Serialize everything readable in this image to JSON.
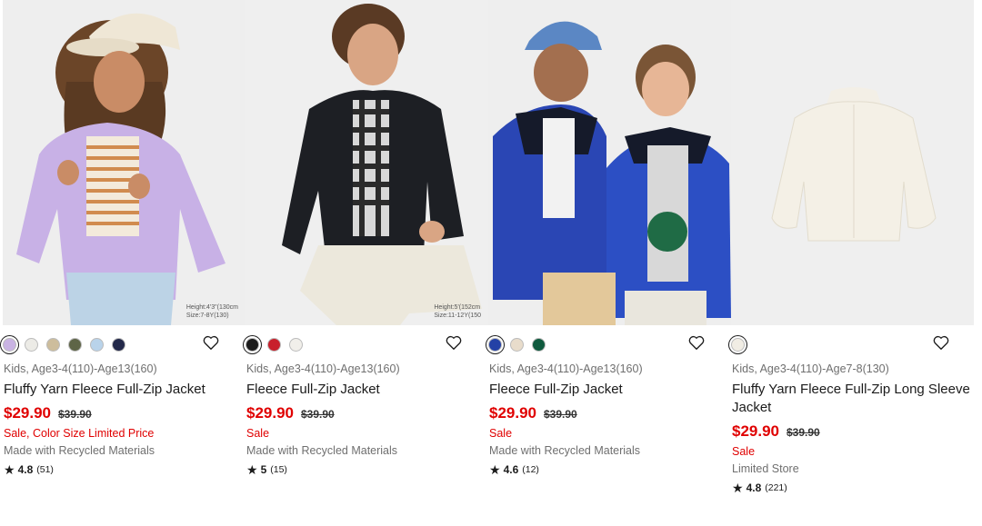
{
  "products": [
    {
      "image_caption": [
        "Height:4'3\"(130cm",
        "Size:7-8Y(130)"
      ],
      "swatches": [
        "#c9b3e3",
        "#ecebe6",
        "#cdbd9c",
        "#5e6547",
        "#b9d3ea",
        "#23294a"
      ],
      "meta": "Kids, Age3-4(110)-Age13(160)",
      "title": "Fluffy Yarn Fleece Full-Zip Jacket",
      "price": "$29.90",
      "old_price": "$39.90",
      "flag": "Sale, Color Size Limited Price",
      "note": "Made with Recycled Materials",
      "rating": "4.8",
      "reviews": "(51)"
    },
    {
      "image_caption": [
        "Height:5'(152cm",
        "Size:11-12Y(150"
      ],
      "swatches": [
        "#1b1b1b",
        "#c8202c",
        "#f1efea"
      ],
      "meta": "Kids, Age3-4(110)-Age13(160)",
      "title": "Fleece Full-Zip Jacket",
      "price": "$29.90",
      "old_price": "$39.90",
      "flag": "Sale",
      "note": "Made with Recycled Materials",
      "rating": "5",
      "reviews": "(15)"
    },
    {
      "image_caption": [],
      "swatches": [
        "#2441a6",
        "#e8dccb",
        "#0f5a3e"
      ],
      "meta": "Kids, Age3-4(110)-Age13(160)",
      "title": "Fleece Full-Zip Jacket",
      "price": "$29.90",
      "old_price": "$39.90",
      "flag": "Sale",
      "note": "Made with Recycled Materials",
      "rating": "4.6",
      "reviews": "(12)"
    },
    {
      "image_caption": [],
      "swatches": [
        "#f1ede4"
      ],
      "meta": "Kids, Age3-4(110)-Age7-8(130)",
      "title": "Fluffy Yarn Fleece Full-Zip Long Sleeve Jacket",
      "price": "$29.90",
      "old_price": "$39.90",
      "flag": "Sale",
      "note": "Limited Store",
      "rating": "4.8",
      "reviews": "(221)"
    }
  ],
  "colors": {
    "sale_red": "#e00000",
    "text": "#1b1b1b",
    "muted": "#6f6f6f"
  }
}
